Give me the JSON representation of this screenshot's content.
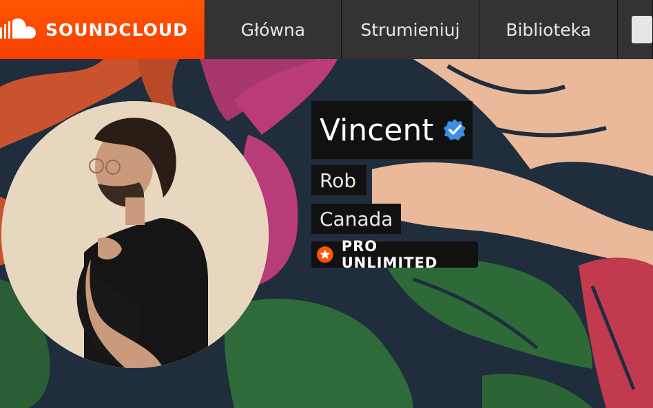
{
  "header": {
    "logo_text": "SOUNDCLOUD",
    "logo_icon": "soundcloud-cloud-icon",
    "brand_color": "#ff5500",
    "nav": [
      {
        "label": "Główna"
      },
      {
        "label": "Strumieniuj"
      },
      {
        "label": "Biblioteka"
      }
    ]
  },
  "profile": {
    "display_name": "Vincent",
    "verified_icon": "verified-check-icon",
    "first_name": "Rob",
    "country": "Canada",
    "badge": {
      "label": "PRO UNLIMITED",
      "icon": "star-icon",
      "color": "#ff5500"
    }
  }
}
